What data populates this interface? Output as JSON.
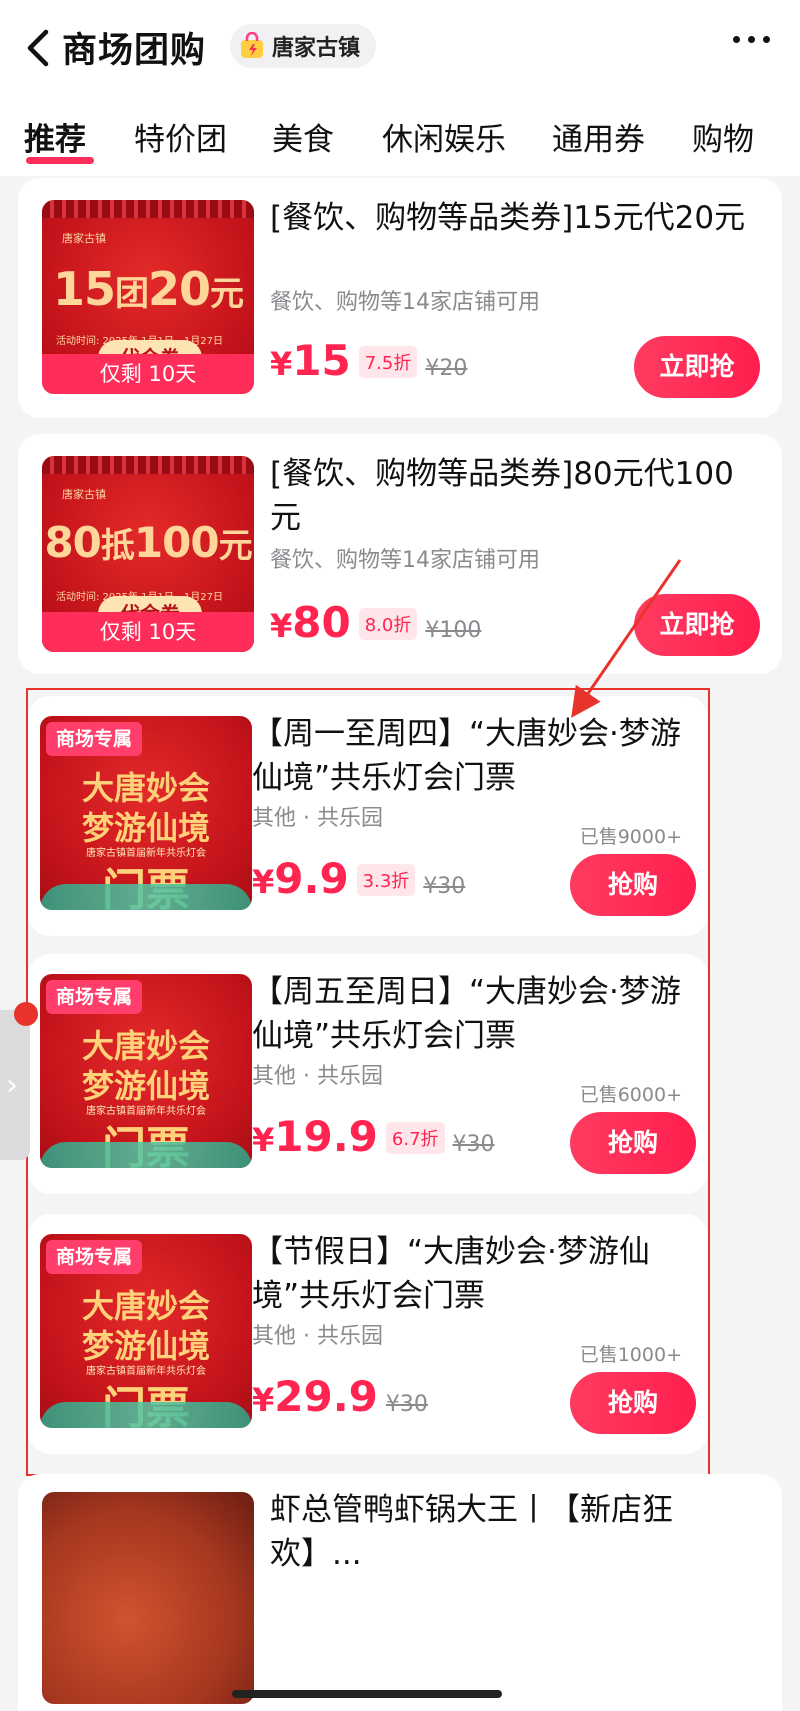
{
  "header": {
    "title": "商场团购",
    "shop_name": "唐家古镇",
    "back_icon": "chevron-left-icon",
    "more_icon": "more-dots-icon"
  },
  "tabs": [
    "推荐",
    "特价团",
    "美食",
    "休闲娱乐",
    "通用券",
    "购物"
  ],
  "active_tab": "推荐",
  "deals": [
    {
      "title": "[餐饮、购物等品类券]15元代20元",
      "sub": "餐饮、购物等14家店铺可用",
      "price": "15",
      "discount": "7.5折",
      "original": "¥20",
      "button": "立即抢",
      "thumb": {
        "brand": "唐家古镇",
        "main_big": "15",
        "main_mid": "团",
        "main_big2": "20",
        "main_unit": "元",
        "date": "活动时间: 2025年 1月1日—1月27日",
        "badge": "代金券",
        "remain": "仅剩 10天"
      }
    },
    {
      "title": "[餐饮、购物等品类券]80元代100元",
      "sub": "餐饮、购物等14家店铺可用",
      "price": "80",
      "discount": "8.0折",
      "original": "¥100",
      "button": "立即抢",
      "thumb": {
        "brand": "唐家古镇",
        "main_big": "80",
        "main_mid": "抵",
        "main_big2": "100",
        "main_unit": "元",
        "date": "活动时间: 2025年 1月1日—1月27日",
        "badge": "代金券",
        "remain": "仅剩 10天"
      }
    },
    {
      "title": "【周一至周四】“大唐妙会·梦游仙境”共乐灯会门票",
      "sub": "其他 · 共乐园",
      "sold": "已售9000+",
      "price": "9.9",
      "discount": "3.3折",
      "original": "¥30",
      "button": "抢购",
      "thumb": {
        "tag": "商场专属",
        "line1": "大唐妙会",
        "line2": "梦游仙境",
        "sub": "唐家古镇首届新年共乐灯会",
        "ticket": "门票"
      }
    },
    {
      "title": "【周五至周日】“大唐妙会·梦游仙境”共乐灯会门票",
      "sub": "其他 · 共乐园",
      "sold": "已售6000+",
      "price": "19.9",
      "discount": "6.7折",
      "original": "¥30",
      "button": "抢购",
      "thumb": {
        "tag": "商场专属",
        "line1": "大唐妙会",
        "line2": "梦游仙境",
        "sub": "唐家古镇首届新年共乐灯会",
        "ticket": "门票"
      }
    },
    {
      "title": "【节假日】“大唐妙会·梦游仙境”共乐灯会门票",
      "sub": "其他 · 共乐园",
      "sold": "已售1000+",
      "price": "29.9",
      "original": "¥30",
      "button": "抢购",
      "thumb": {
        "tag": "商场专属",
        "line1": "大唐妙会",
        "line2": "梦游仙境",
        "sub": "唐家古镇首届新年共乐灯会",
        "ticket": "门票"
      }
    }
  ],
  "next_item_title": "虾总管鸭虾锅大王丨【新店狂欢】...",
  "currency": "¥",
  "colors": {
    "accent": "#ff2d5a",
    "annotation": "#e8332d"
  }
}
